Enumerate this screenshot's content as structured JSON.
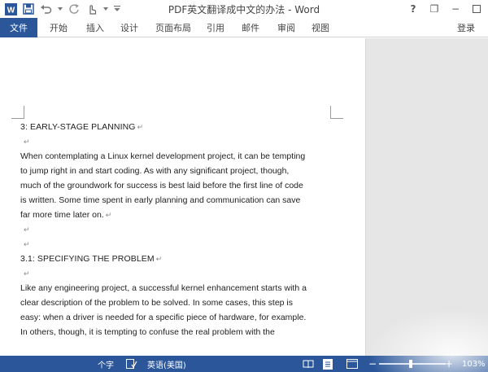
{
  "app": {
    "title": "PDF英文翻译成中文的办法 - Word"
  },
  "title_bar": {
    "help": "?",
    "minimize": "−",
    "restore": "❐"
  },
  "ribbon": {
    "file_tab": "文件",
    "tabs": [
      "开始",
      "插入",
      "设计",
      "页面布局",
      "引用",
      "邮件",
      "审阅",
      "视图"
    ],
    "login": "登录"
  },
  "document": {
    "heading1": "3: EARLY-STAGE PLANNING",
    "para1": [
      "When contemplating a Linux kernel development project, it can be tempting",
      "to jump right in and start coding. As with any significant project, though,",
      "much of the groundwork for success is best laid before the first line of code",
      "is written. Some time spent in early planning and communication can save",
      "far more time later on."
    ],
    "heading2": "3.1: SPECIFYING THE PROBLEM",
    "para2": [
      "Like any engineering project, a successful kernel enhancement starts with a",
      "clear description of the problem to be solved. In some cases, this step is",
      "easy: when a driver is needed for a specific piece of hardware, for example.",
      "In others, though, it is tempting to confuse the real problem with the"
    ],
    "pilcrow": "↵"
  },
  "status_bar": {
    "word_count": "个字",
    "language": "英语(美国)",
    "zoom": "103%"
  },
  "colors": {
    "accent": "#2b579a",
    "page_bg": "#ffffff",
    "canvas_bg": "#e6e6e6"
  }
}
